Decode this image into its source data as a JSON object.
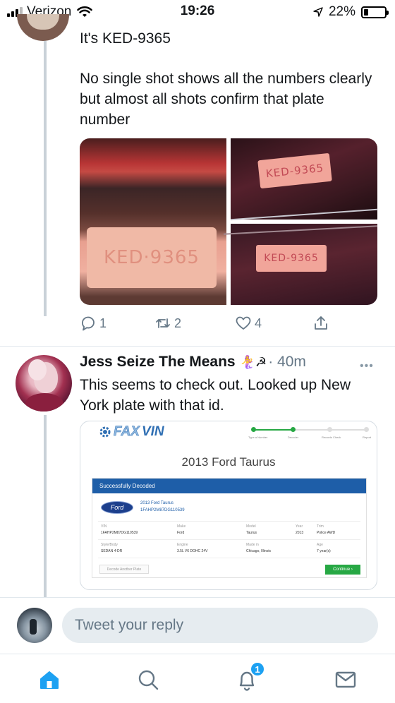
{
  "status_bar": {
    "carrier": "Verizon",
    "time": "19:26",
    "battery": "22%",
    "battery_level": 0.22
  },
  "tweet": {
    "line1": "It's KED-9365",
    "body": "No single shot shows all the numbers clearly but almost all shots confirm that plate number",
    "media": {
      "plate_left": "KED·9365",
      "plate_top_right": "KED-9365",
      "plate_bottom_right": "KED-9365"
    },
    "actions": {
      "replies": "1",
      "retweets": "2",
      "likes": "4"
    }
  },
  "reply": {
    "name": "Jess Seize The Means",
    "emojis": "🧜‍♀️☭",
    "separator_time": "· 40m",
    "more": "•••",
    "text": "This seems to check out. Looked up New York plate with that id.",
    "card": {
      "logo_prefix": "FAX",
      "logo_suffix": "VIN",
      "steps": [
        "Type a Number",
        "Decoder",
        "Records Check",
        "Report"
      ],
      "title": "2013 Ford Taurus",
      "band": "Successfully Decoded",
      "ford_logo": "Ford",
      "decoded_model": "2013 Ford Taurus",
      "decoded_vin": "1FAHP2M87DG110539",
      "fields": {
        "vin_k": "VIN",
        "vin_v": "1FAHP2M87DG110539",
        "make_k": "Make",
        "make_v": "Ford",
        "model_k": "Model",
        "model_v": "Taurus",
        "year_k": "Year",
        "year_v": "2013",
        "trim_k": "Trim",
        "trim_v": "Police AWD",
        "style_k": "Style/Body",
        "style_v": "SEDAN 4-DR",
        "engine_k": "Engine",
        "engine_v": "3.5L V6 DOHC 24V",
        "madein_k": "Made in",
        "madein_v": "Chicago, Illinois",
        "age_k": "Age",
        "age_v": "7 year(s)"
      },
      "decode_another": "Decode Another Plate",
      "continue": "Continue ›"
    }
  },
  "reply_bar": {
    "placeholder": "Tweet your reply"
  },
  "tab_bar": {
    "notifications_badge": "1",
    "active_tab": "home",
    "accent": "#1da1f2"
  }
}
